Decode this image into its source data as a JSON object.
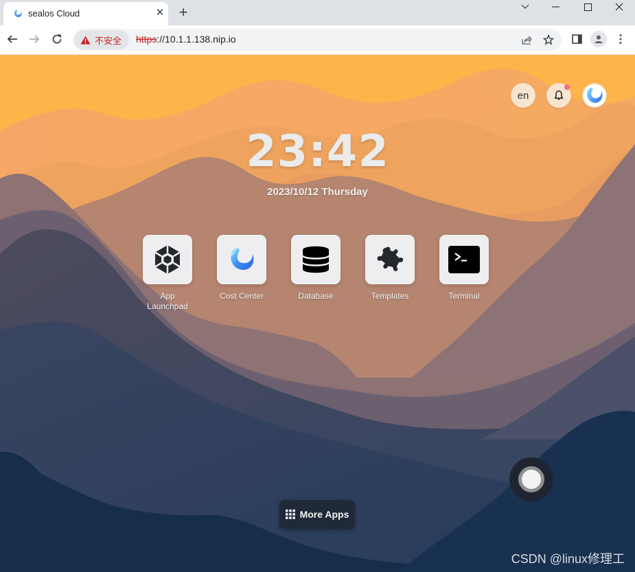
{
  "browser": {
    "tab": {
      "title": "sealos Cloud",
      "favicon": "sealos-logo-icon",
      "close_icon": "close-icon"
    },
    "new_tab_icon": "plus-icon",
    "window_controls": [
      "chevron-down-icon",
      "minimize-icon",
      "maximize-icon",
      "close-icon"
    ],
    "nav": [
      "back-arrow-icon",
      "forward-arrow-icon",
      "reload-icon"
    ],
    "security": {
      "icon": "warning-triangle-icon",
      "label": "不安全"
    },
    "url": {
      "scheme": "https",
      "rest": "://10.1.1.138.nip.io"
    },
    "toolbar_icons": [
      "share-icon",
      "bookmark-star-icon",
      "side-panel-icon",
      "profile-icon",
      "more-menu-icon"
    ]
  },
  "desktop": {
    "top_right": {
      "language_label": "en",
      "notification_icon": "bell-icon",
      "has_unread": true,
      "avatar_icon": "sealos-logo-icon"
    },
    "clock": {
      "time": "23:42",
      "date": "2023/10/12 Thursday"
    },
    "apps": [
      {
        "name": "App Launchpad",
        "line1": "App",
        "line2": "Launchpad",
        "icon": "hexagon-cube-icon"
      },
      {
        "name": "Cost Center",
        "line1": "Cost Center",
        "line2": "",
        "icon": "sealos-logo-icon"
      },
      {
        "name": "Database",
        "line1": "Database",
        "line2": "",
        "icon": "database-icon"
      },
      {
        "name": "Templates",
        "line1": "Templates",
        "line2": "",
        "icon": "puzzle-piece-icon"
      },
      {
        "name": "Terminal",
        "line1": "Terminal",
        "line2": "",
        "icon": "terminal-icon"
      }
    ],
    "more_apps": {
      "label": "More Apps",
      "icon": "grid-icon"
    },
    "floating_button_icon": "assistive-touch-icon",
    "watermark": "CSDN @linux修理工"
  },
  "colors": {
    "sky": "#ffb74a",
    "mountain_dark": "#162d4b",
    "accent_blue": "#3a8ef0",
    "insecure_red": "#c5221f",
    "notify_dot": "#f26f8c"
  }
}
